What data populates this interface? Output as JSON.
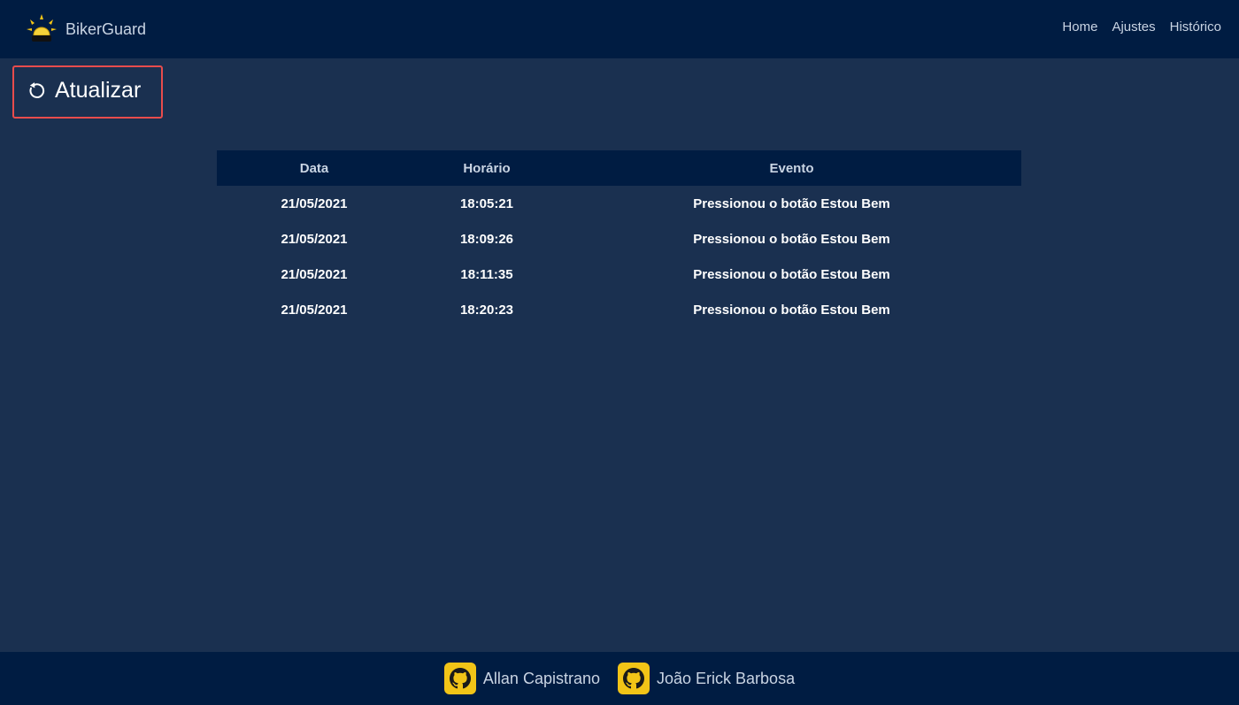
{
  "navbar": {
    "brand_name": "BikerGuard",
    "links": [
      "Home",
      "Ajustes",
      "Histórico"
    ]
  },
  "toolbar": {
    "refresh_label": "Atualizar",
    "refresh_icon": "refresh-icon"
  },
  "table": {
    "headers": [
      "Data",
      "Horário",
      "Evento"
    ],
    "rows": [
      [
        "21/05/2021",
        "18:05:21",
        "Pressionou o botão Estou Bem"
      ],
      [
        "21/05/2021",
        "18:09:26",
        "Pressionou o botão Estou Bem"
      ],
      [
        "21/05/2021",
        "18:11:35",
        "Pressionou o botão Estou Bem"
      ],
      [
        "21/05/2021",
        "18:20:23",
        "Pressionou o botão Estou Bem"
      ]
    ]
  },
  "footer": {
    "authors": [
      {
        "name": "Allan Capistrano",
        "icon": "github-icon"
      },
      {
        "name": "João Erick Barbosa",
        "icon": "github-icon"
      }
    ]
  },
  "colors": {
    "background": "#1a3050",
    "navbar": "#001c42",
    "accent_yellow": "#f2c417",
    "highlight_border": "#e84c4c"
  }
}
